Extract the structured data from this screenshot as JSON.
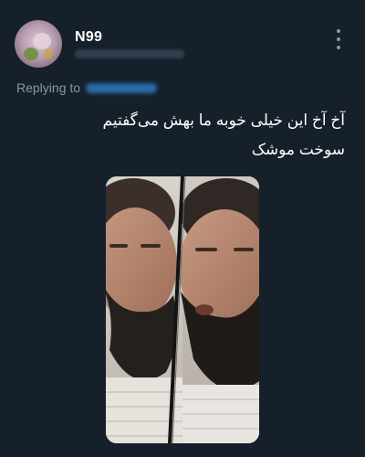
{
  "tweet": {
    "display_name": "N99",
    "replying_to_label": "Replying to",
    "text_line1": "آخ آخ این خیلی خوبه ما بهش می‌گفتیم",
    "text_line2": "سوخت موشک"
  },
  "icons": {
    "more": "more-vertical-icon"
  },
  "colors": {
    "background": "#15202b",
    "secondary_text": "#8899a6",
    "link": "#1d9bf0"
  }
}
